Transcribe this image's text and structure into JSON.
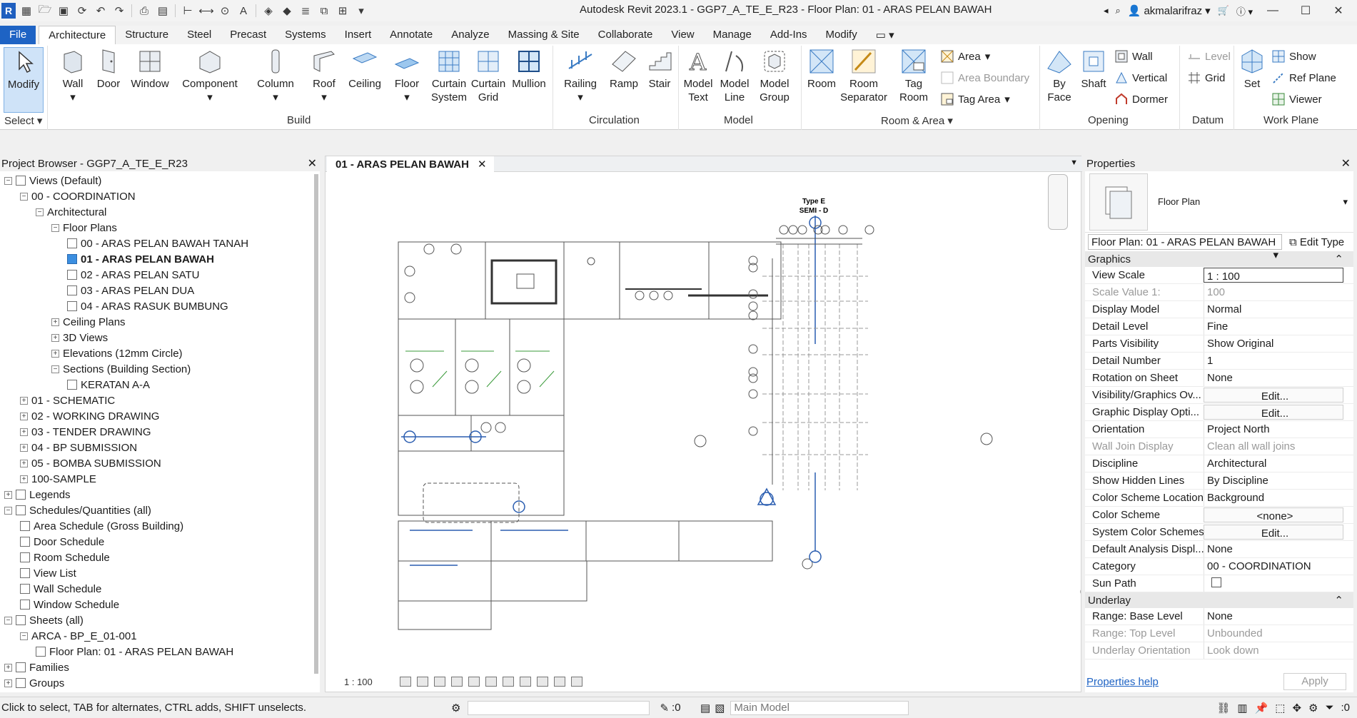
{
  "window": {
    "title": "Autodesk Revit 2023.1 - GGP7_A_TE_E_R23 - Floor Plan: 01 - ARAS PELAN BAWAH",
    "user": "akmalarifraz"
  },
  "tabs": [
    "File",
    "Architecture",
    "Structure",
    "Steel",
    "Precast",
    "Systems",
    "Insert",
    "Annotate",
    "Analyze",
    "Massing & Site",
    "Collaborate",
    "View",
    "Manage",
    "Add-Ins",
    "Modify"
  ],
  "ribbon": {
    "modify": "Modify",
    "select": "Select",
    "build": {
      "label": "Build",
      "wall": "Wall",
      "door": "Door",
      "window": "Window",
      "component": "Component",
      "column": "Column",
      "roof": "Roof",
      "ceiling": "Ceiling",
      "floor": "Floor",
      "curtain_system": "Curtain System",
      "curtain_grid": "Curtain Grid",
      "mullion": "Mullion"
    },
    "circulation": {
      "label": "Circulation",
      "railing": "Railing",
      "ramp": "Ramp",
      "stair": "Stair"
    },
    "model": {
      "label": "Model",
      "model_text": "Model Text",
      "model_line": "Model Line",
      "model_group": "Model Group"
    },
    "room_area": {
      "label": "Room & Area",
      "room": "Room",
      "room_separator": "Room Separator",
      "tag_room": "Tag Room",
      "area": "Area",
      "area_boundary": "Area  Boundary",
      "tag_area": "Tag  Area"
    },
    "opening": {
      "label": "Opening",
      "by_face": "By Face",
      "shaft": "Shaft",
      "wall": "Wall",
      "vertical": "Vertical",
      "dormer": "Dormer"
    },
    "datum": {
      "label": "Datum",
      "level": "Level",
      "grid": "Grid"
    },
    "work_plane": {
      "label": "Work Plane",
      "set": "Set",
      "show": "Show",
      "ref_plane": "Ref  Plane",
      "viewer": "Viewer"
    }
  },
  "project_browser": {
    "title": "Project Browser - GGP7_A_TE_E_R23",
    "items": [
      {
        "label": "Views (Default)",
        "level": 0,
        "exp": "−",
        "icon": true
      },
      {
        "label": "00 - COORDINATION",
        "level": 1,
        "exp": "−"
      },
      {
        "label": "Architectural",
        "level": 2,
        "exp": "−"
      },
      {
        "label": "Floor Plans",
        "level": 3,
        "exp": "−"
      },
      {
        "label": "00 - ARAS PELAN BAWAH TANAH",
        "level": 4,
        "view": true
      },
      {
        "label": "01 - ARAS PELAN BAWAH",
        "level": 4,
        "view": true,
        "bold": true,
        "selected": true
      },
      {
        "label": "02 - ARAS PELAN SATU",
        "level": 4,
        "view": true
      },
      {
        "label": "03 - ARAS PELAN DUA",
        "level": 4,
        "view": true
      },
      {
        "label": "04 - ARAS RASUK BUMBUNG",
        "level": 4,
        "view": true
      },
      {
        "label": "Ceiling Plans",
        "level": 3,
        "exp": "+"
      },
      {
        "label": "3D Views",
        "level": 3,
        "exp": "+"
      },
      {
        "label": "Elevations (12mm Circle)",
        "level": 3,
        "exp": "+"
      },
      {
        "label": "Sections (Building Section)",
        "level": 3,
        "exp": "−"
      },
      {
        "label": "KERATAN A-A",
        "level": 4,
        "view": true
      },
      {
        "label": "01 - SCHEMATIC",
        "level": 1,
        "exp": "+"
      },
      {
        "label": "02 - WORKING DRAWING",
        "level": 1,
        "exp": "+"
      },
      {
        "label": "03 - TENDER DRAWING",
        "level": 1,
        "exp": "+"
      },
      {
        "label": "04 - BP SUBMISSION",
        "level": 1,
        "exp": "+"
      },
      {
        "label": "05 - BOMBA SUBMISSION",
        "level": 1,
        "exp": "+"
      },
      {
        "label": "100-SAMPLE",
        "level": 1,
        "exp": "+"
      },
      {
        "label": "Legends",
        "level": 0,
        "exp": "+",
        "icon": true
      },
      {
        "label": "Schedules/Quantities (all)",
        "level": 0,
        "exp": "−",
        "icon": true
      },
      {
        "label": "Area Schedule (Gross Building)",
        "level": 1,
        "view": true
      },
      {
        "label": "Door Schedule",
        "level": 1,
        "view": true
      },
      {
        "label": "Room Schedule",
        "level": 1,
        "view": true
      },
      {
        "label": "View List",
        "level": 1,
        "view": true
      },
      {
        "label": "Wall Schedule",
        "level": 1,
        "view": true
      },
      {
        "label": "Window Schedule",
        "level": 1,
        "view": true
      },
      {
        "label": "Sheets (all)",
        "level": 0,
        "exp": "−",
        "icon": true
      },
      {
        "label": "ARCA - BP_E_01-001",
        "level": 1,
        "exp": "−"
      },
      {
        "label": "Floor Plan: 01 - ARAS PELAN BAWAH",
        "level": 2,
        "view": true
      },
      {
        "label": "Families",
        "level": 0,
        "exp": "+",
        "icon": true
      },
      {
        "label": "Groups",
        "level": 0,
        "exp": "+",
        "icon": true
      }
    ]
  },
  "view": {
    "tab": "01 - ARAS PELAN BAWAH",
    "scale": "1 : 100",
    "type_label": "Type E",
    "type_sub": "SEMI - D"
  },
  "properties": {
    "title": "Properties",
    "type": "Floor Plan",
    "selector": "Floor Plan: 01 - ARAS PELAN BAWAH",
    "edit_type": "Edit Type",
    "groups": [
      {
        "name": "Graphics",
        "rows": [
          {
            "k": "View Scale",
            "v": "1 : 100",
            "style": "box"
          },
          {
            "k": "Scale Value    1:",
            "v": "100",
            "dim": true
          },
          {
            "k": "Display Model",
            "v": "Normal"
          },
          {
            "k": "Detail Level",
            "v": "Fine"
          },
          {
            "k": "Parts Visibility",
            "v": "Show Original"
          },
          {
            "k": "Detail Number",
            "v": "1"
          },
          {
            "k": "Rotation on Sheet",
            "v": "None"
          },
          {
            "k": "Visibility/Graphics Ov...",
            "v": "Edit...",
            "style": "btn"
          },
          {
            "k": "Graphic Display Opti...",
            "v": "Edit...",
            "style": "btn"
          },
          {
            "k": "Orientation",
            "v": "Project North"
          },
          {
            "k": "Wall Join Display",
            "v": "Clean all wall joins",
            "dim": true
          },
          {
            "k": "Discipline",
            "v": "Architectural"
          },
          {
            "k": "Show Hidden Lines",
            "v": "By Discipline"
          },
          {
            "k": "Color Scheme Location",
            "v": "Background"
          },
          {
            "k": "Color Scheme",
            "v": "<none>",
            "style": "btn"
          },
          {
            "k": "System Color Schemes",
            "v": "Edit...",
            "style": "btn"
          },
          {
            "k": "Default Analysis Displ...",
            "v": "None"
          },
          {
            "k": "Category",
            "v": "00 - COORDINATION"
          },
          {
            "k": "Sun Path",
            "v": "",
            "style": "check"
          }
        ]
      },
      {
        "name": "Underlay",
        "rows": [
          {
            "k": "Range: Base Level",
            "v": "None"
          },
          {
            "k": "Range: Top Level",
            "v": "Unbounded",
            "dim": true
          },
          {
            "k": "Underlay Orientation",
            "v": "Look down",
            "dim": true
          }
        ]
      }
    ],
    "help": "Properties help",
    "apply": "Apply"
  },
  "status": {
    "message": "Click to select, TAB for alternates, CTRL adds, SHIFT unselects.",
    "workset_count": ":0",
    "model": "Main Model",
    "filter_count": ":0"
  }
}
